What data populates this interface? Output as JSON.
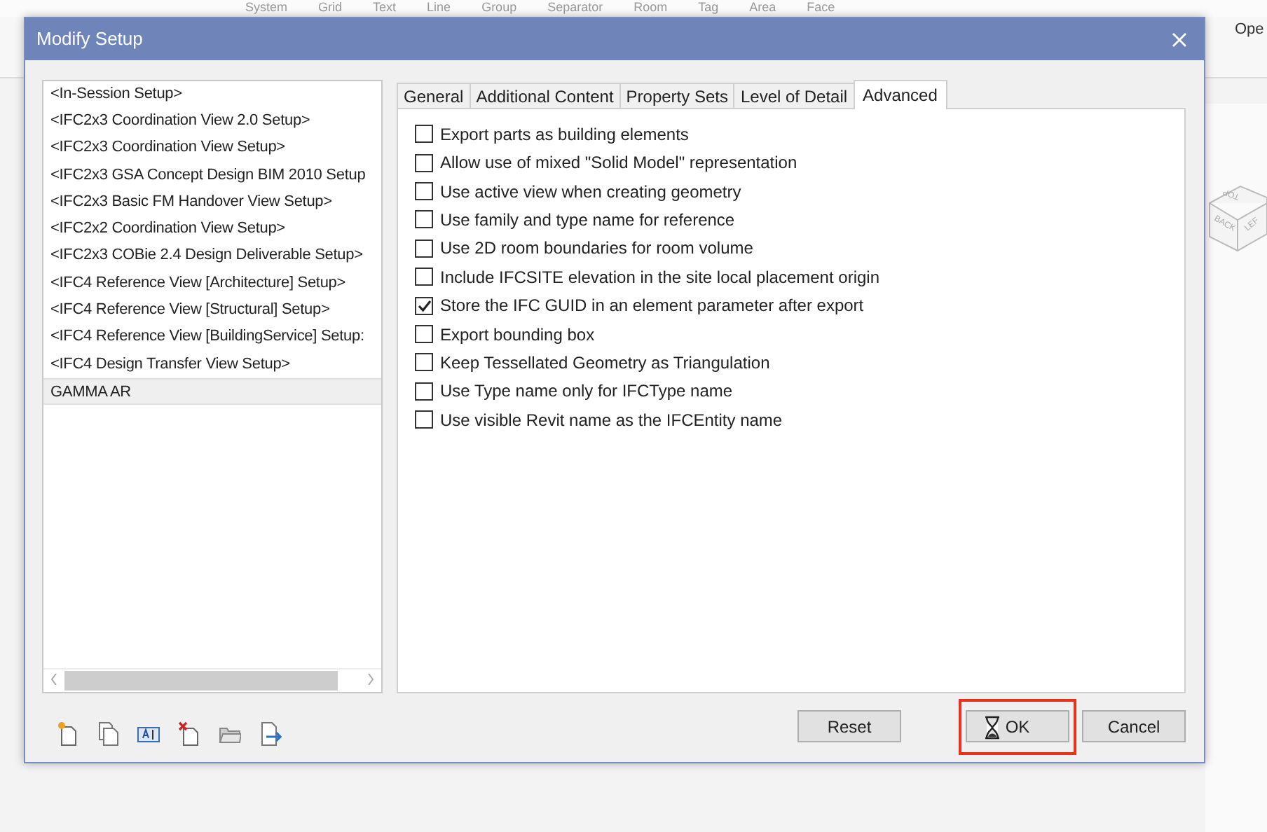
{
  "background_app": {
    "ribbon_labels": [
      "System",
      "Grid",
      "Text",
      "Line",
      "Group",
      "Separator",
      "Room",
      "Tag",
      "Area",
      "Face"
    ],
    "menu_item": "Ope",
    "view_cube_faces": [
      "TOP",
      "BACK",
      "LEF"
    ]
  },
  "window": {
    "title": "Modify Setup"
  },
  "setups": [
    {
      "label": "<In-Session Setup>",
      "selected": false
    },
    {
      "label": "<IFC2x3 Coordination View 2.0 Setup>",
      "selected": false
    },
    {
      "label": "<IFC2x3 Coordination View Setup>",
      "selected": false
    },
    {
      "label": "<IFC2x3 GSA Concept Design BIM 2010 Setup",
      "selected": false
    },
    {
      "label": "<IFC2x3 Basic FM Handover View Setup>",
      "selected": false
    },
    {
      "label": "<IFC2x2 Coordination View Setup>",
      "selected": false
    },
    {
      "label": "<IFC2x3 COBie 2.4 Design Deliverable Setup>",
      "selected": false
    },
    {
      "label": "<IFC4 Reference View [Architecture] Setup>",
      "selected": false
    },
    {
      "label": "<IFC4 Reference View [Structural] Setup>",
      "selected": false
    },
    {
      "label": "<IFC4 Reference View [BuildingService] Setup:",
      "selected": false
    },
    {
      "label": "<IFC4 Design Transfer View Setup>",
      "selected": false
    },
    {
      "label": "GAMMA AR",
      "selected": true
    }
  ],
  "tabs": [
    {
      "label": "General",
      "selected": false
    },
    {
      "label": "Additional Content",
      "selected": false
    },
    {
      "label": "Property Sets",
      "selected": false
    },
    {
      "label": "Level of Detail",
      "selected": false
    },
    {
      "label": "Advanced",
      "selected": true
    }
  ],
  "options": [
    {
      "label": "Export parts as building elements",
      "checked": false
    },
    {
      "label": "Allow use of mixed \"Solid Model\" representation",
      "checked": false
    },
    {
      "label": "Use active view when creating geometry",
      "checked": false
    },
    {
      "label": "Use family and type name for reference",
      "checked": false
    },
    {
      "label": "Use 2D room boundaries for room volume",
      "checked": false
    },
    {
      "label": "Include IFCSITE elevation in the site local placement origin",
      "checked": false
    },
    {
      "label": "Store the IFC GUID in an element parameter after export",
      "checked": true
    },
    {
      "label": "Export bounding box",
      "checked": false
    },
    {
      "label": "Keep Tessellated Geometry as Triangulation",
      "checked": false
    },
    {
      "label": "Use Type name only for IFCType name",
      "checked": false
    },
    {
      "label": "Use visible Revit name as the IFCEntity name",
      "checked": false
    }
  ],
  "buttons": [
    {
      "label": "Reset",
      "highlighted": false
    },
    {
      "label": "OK",
      "highlighted": true
    },
    {
      "label": "Cancel",
      "highlighted": false
    }
  ]
}
